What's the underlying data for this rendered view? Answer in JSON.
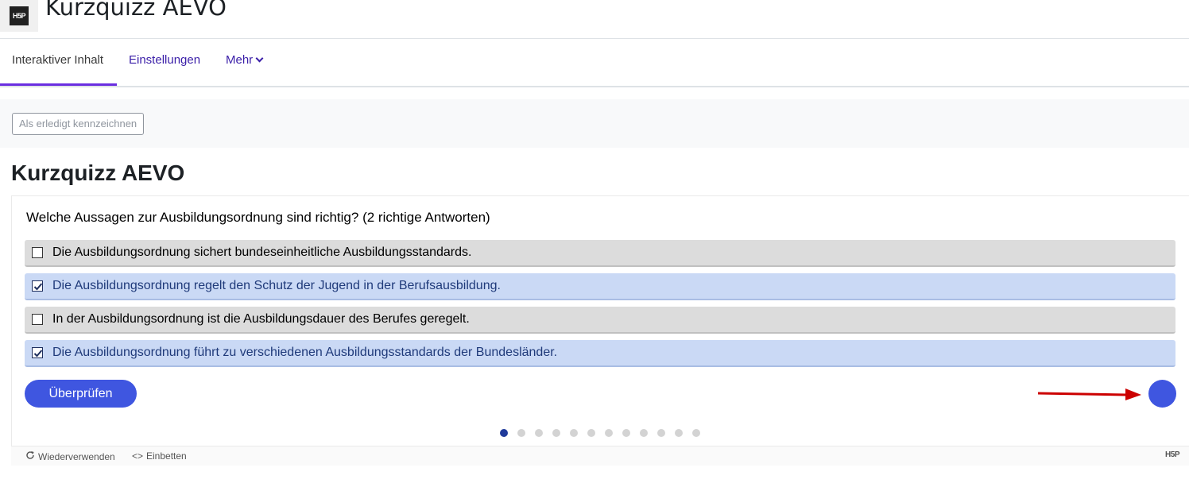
{
  "header": {
    "title": "Kurzquizz AEVO",
    "logo_text": "H5P"
  },
  "tabs": [
    {
      "label": "Interaktiver Inhalt",
      "active": true
    },
    {
      "label": "Einstellungen",
      "active": false
    },
    {
      "label": "Mehr",
      "active": false,
      "has_dropdown": true
    }
  ],
  "activity": {
    "done_button": "Als erledigt kennzeichnen"
  },
  "main": {
    "title": "Kurzquizz AEVO"
  },
  "quiz": {
    "question": "Welche Aussagen zur Ausbildungsordnung sind richtig? (2 richtige Antworten)",
    "answers": [
      {
        "text": "Die Ausbildungsordnung sichert bundeseinheitliche Ausbildungsstandards.",
        "checked": false
      },
      {
        "text": "Die Ausbildungsordnung regelt den Schutz der Jugend in der Berufsausbildung.",
        "checked": true
      },
      {
        "text": "In der Ausbildungsordnung ist die Ausbildungsdauer des Berufes geregelt.",
        "checked": false
      },
      {
        "text": "Die Ausbildungsordnung führt zu verschiedenen Ausbildungsstandards der Bundesländer.",
        "checked": true
      }
    ],
    "check_button": "Überprüfen",
    "slides_total": 12,
    "current_slide": 1
  },
  "footer": {
    "reuse": "Wiederverwenden",
    "embed": "Einbetten",
    "brand": "H5P"
  },
  "colors": {
    "accent": "#3f56e0",
    "tab_active_underline": "#6a2ee0",
    "checked_bg": "#cad9f5",
    "unchecked_bg": "#dcdcdc",
    "annotation_arrow": "#cc0000"
  }
}
